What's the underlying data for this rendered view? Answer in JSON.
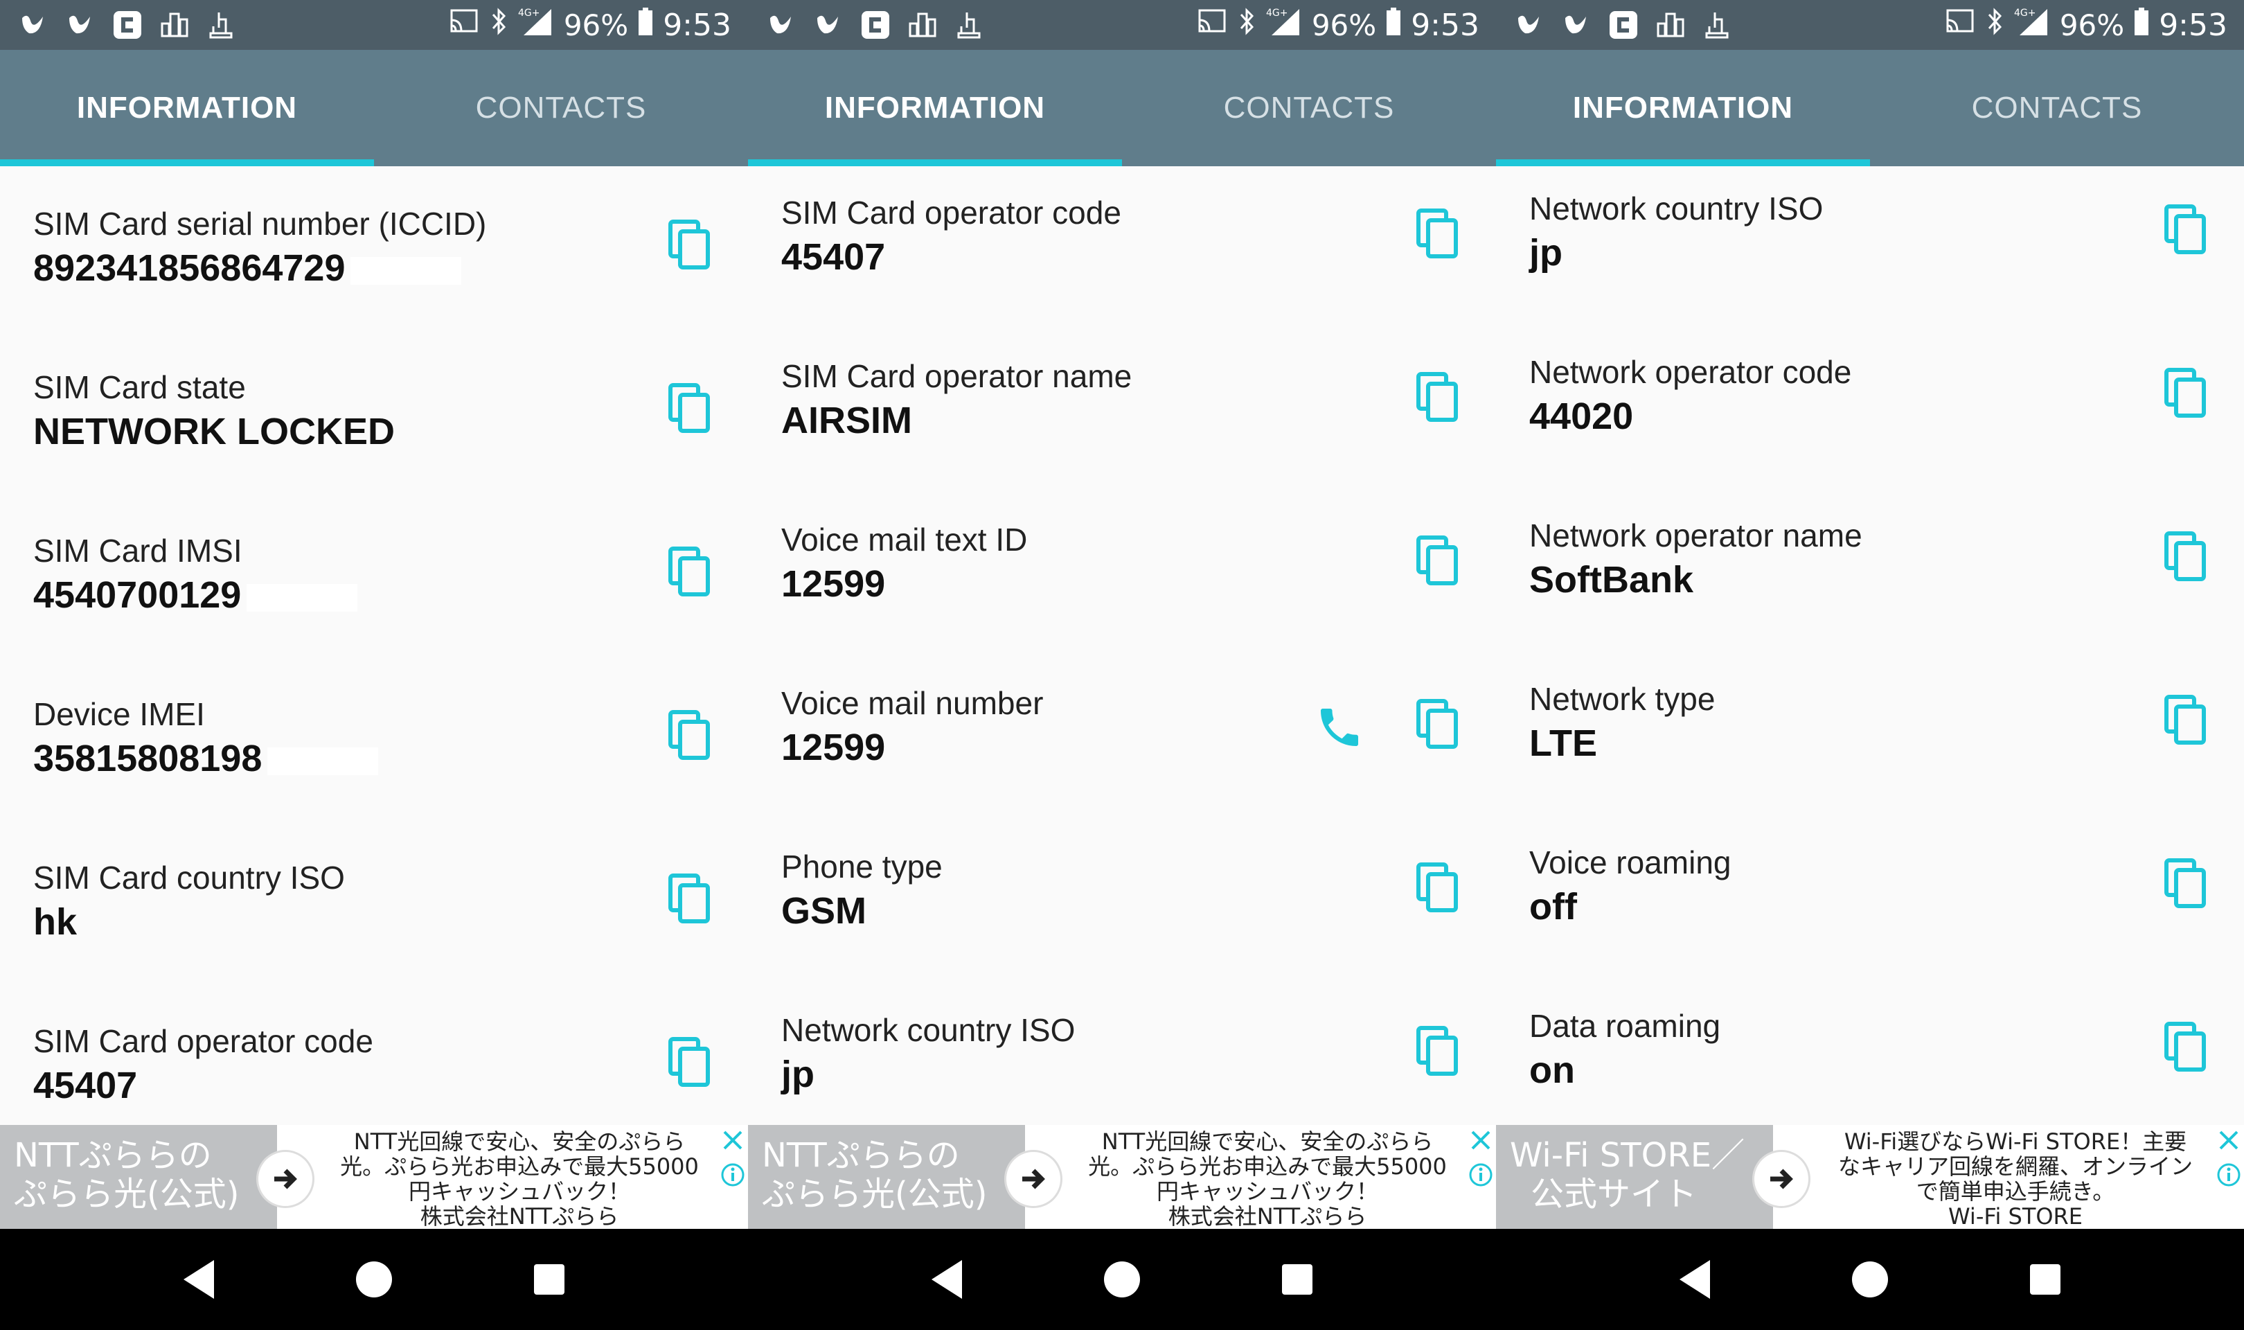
{
  "status_bar": {
    "battery_percent": "96%",
    "time": "9:53",
    "network_badge": "4G+",
    "left_icons": [
      "swirl-icon",
      "swirl-icon",
      "app-c-icon",
      "podium-icon",
      "hand-pointer-icon"
    ],
    "right_icons": [
      "cast-icon",
      "bluetooth-icon",
      "signal-icon",
      "battery-icon"
    ]
  },
  "tabs": {
    "information": "INFORMATION",
    "contacts": "CONTACTS"
  },
  "colors": {
    "status_bar": "#4d5d67",
    "tab_bar": "#607d8b",
    "accent": "#1ec6d8",
    "background": "#fafafa"
  },
  "screens": [
    {
      "rows": [
        {
          "label": "SIM Card serial number (ICCID)",
          "value": "892341856864729",
          "redacted": true
        },
        {
          "label": "SIM Card state",
          "value": "NETWORK LOCKED"
        },
        {
          "label": "SIM Card IMSI",
          "value": "4540700129",
          "redacted": true
        },
        {
          "label": "Device IMEI",
          "value": "35815808198",
          "redacted": true
        },
        {
          "label": "SIM Card country ISO",
          "value": "hk"
        },
        {
          "label": "SIM Card operator code",
          "value": "45407"
        }
      ],
      "ad": {
        "left_line1": "NTTぷららの",
        "left_line2": "ぷらら光(公式)",
        "text_line1": "NTT光回線で安心、安全のぷらら",
        "text_line2": "光。ぷらら光お申込みで最大55000",
        "text_line3": "円キャッシュバック！",
        "text_line4": "株式会社NTTぷらら"
      }
    },
    {
      "rows": [
        {
          "label": "SIM Card operator code",
          "value": "45407"
        },
        {
          "label": "SIM Card operator name",
          "value": "AIRSIM"
        },
        {
          "label": "Voice mail text ID",
          "value": "12599"
        },
        {
          "label": "Voice mail number",
          "value": "12599",
          "phone": true
        },
        {
          "label": "Phone type",
          "value": "GSM"
        },
        {
          "label": "Network country ISO",
          "value": "jp"
        }
      ],
      "ad": {
        "left_line1": "NTTぷららの",
        "left_line2": "ぷらら光(公式)",
        "text_line1": "NTT光回線で安心、安全のぷらら",
        "text_line2": "光。ぷらら光お申込みで最大55000",
        "text_line3": "円キャッシュバック！",
        "text_line4": "株式会社NTTぷらら"
      }
    },
    {
      "rows": [
        {
          "label": "Network country ISO",
          "value": "jp"
        },
        {
          "label": "Network operator code",
          "value": "44020"
        },
        {
          "label": "Network operator name",
          "value": "SoftBank"
        },
        {
          "label": "Network type",
          "value": "LTE"
        },
        {
          "label": "Voice roaming",
          "value": "off"
        },
        {
          "label": "Data roaming",
          "value": "on"
        }
      ],
      "ad": {
        "left_line1": "Wi-Fi STORE／",
        "left_line2": "公式サイト",
        "text_line1": "Wi-Fi選びならWi-Fi STORE！主要",
        "text_line2": "なキャリア回線を網羅、オンライン",
        "text_line3": "で簡単申込手続き。",
        "text_line4": "Wi-Fi STORE"
      }
    }
  ],
  "nav": [
    "back-icon",
    "home-icon",
    "recents-icon"
  ]
}
